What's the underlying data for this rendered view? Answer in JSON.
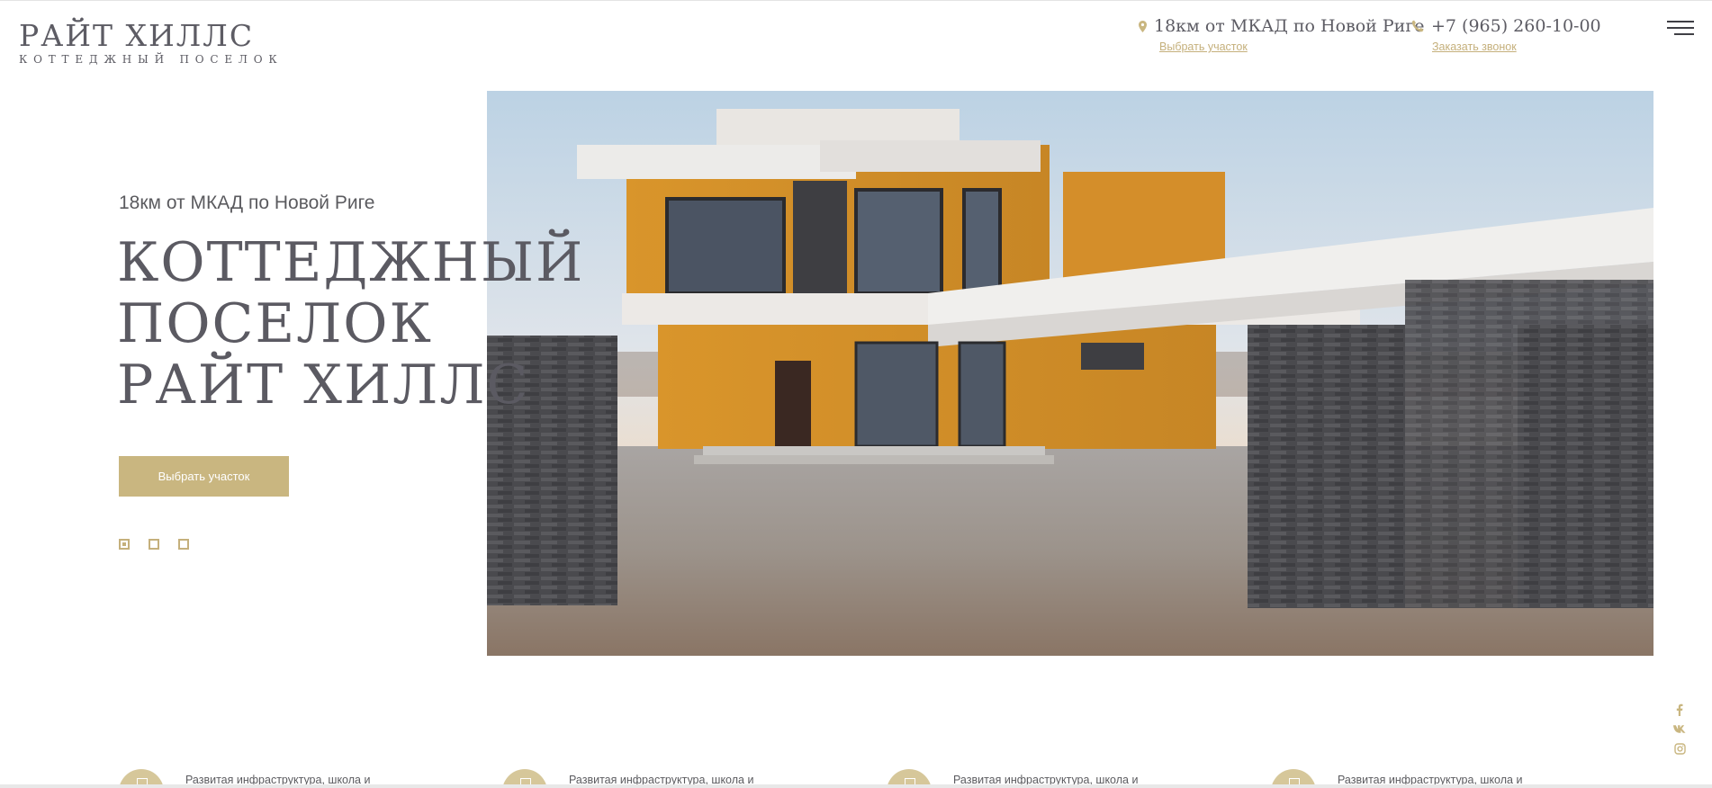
{
  "brand": {
    "title": "РАЙТ ХИЛЛС",
    "subtitle": "КОТТЕДЖНЫЙ ПОСЕЛОК"
  },
  "header": {
    "address": {
      "icon": "location-pin-icon",
      "text": "18км от МКАД по Новой Риге",
      "link": "Выбрать участок"
    },
    "phone": {
      "icon": "phone-icon",
      "text": "+7 (965) 260-10-00",
      "link": "Заказать звонок"
    },
    "menu_icon": "hamburger-menu-icon"
  },
  "hero": {
    "kicker": "18км от МКАД по Новой Риге",
    "title_lines": [
      "КОТТЕДЖНЫЙ",
      "ПОСЕЛОК",
      "РАЙТ ХИЛЛС"
    ],
    "cta_label": "Выбрать участок",
    "slide_count": 3,
    "active_slide": 1,
    "image_subject": "modern two-storey cottage with wooden facade and stone pillars"
  },
  "social": [
    "facebook-icon",
    "vk-icon",
    "instagram-icon"
  ],
  "features": [
    {
      "icon": "feature-emblem-icon",
      "text": "Развитая инфраструктура, школа и"
    },
    {
      "icon": "feature-emblem-icon",
      "text": "Развитая инфраструктура, школа и"
    },
    {
      "icon": "feature-emblem-icon",
      "text": "Развитая инфраструктура, школа и"
    },
    {
      "icon": "feature-emblem-icon",
      "text": "Развитая инфраструктура, школа и"
    }
  ],
  "colors": {
    "accent": "#c9b680",
    "text": "#5b5b5f",
    "link": "#c5b07c"
  }
}
